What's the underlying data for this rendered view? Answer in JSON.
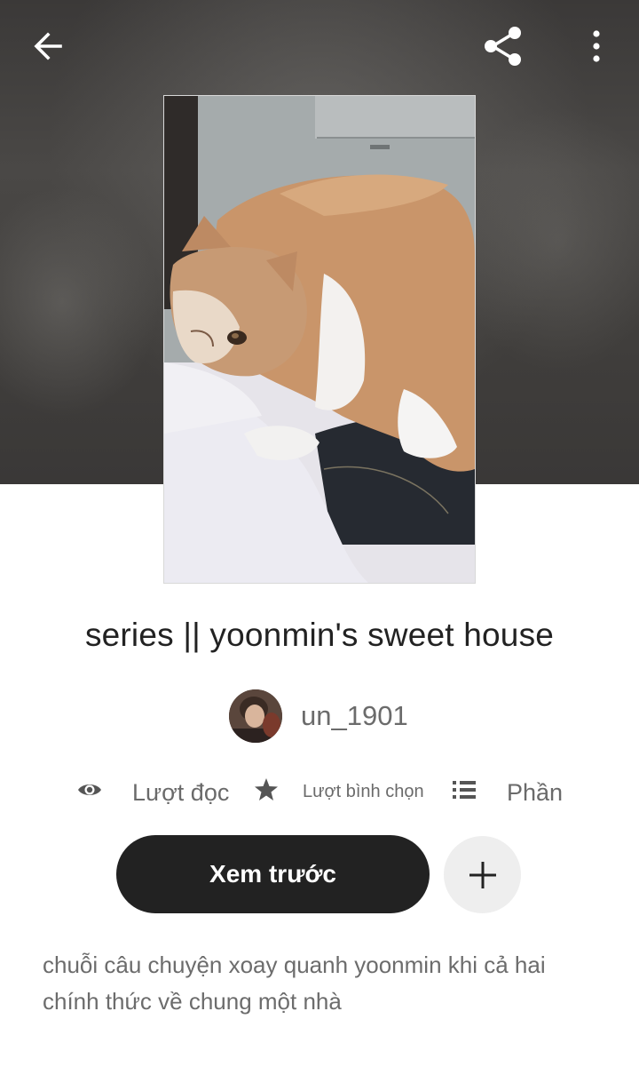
{
  "toolbar": {
    "back_icon": "arrow-left-icon",
    "share_icon": "share-icon",
    "more_icon": "more-vertical-icon"
  },
  "story": {
    "title": "series || yoonmin's sweet house",
    "author": "un_1901",
    "description_line1": "chuỗi câu chuyện xoay quanh yoonmin khi cả hai",
    "description_line2": "chính thức về chung một nhà"
  },
  "stats": {
    "reads_label": "Lượt đọc",
    "votes_label": "Lượt bình chọn",
    "parts_label": "Phần"
  },
  "actions": {
    "preview_label": "Xem trước",
    "add_icon": "plus-icon"
  },
  "colors": {
    "primary_button": "#222222",
    "text_dark": "#222222",
    "text_muted": "#6a6a6a",
    "add_button_bg": "#eeeeee"
  }
}
